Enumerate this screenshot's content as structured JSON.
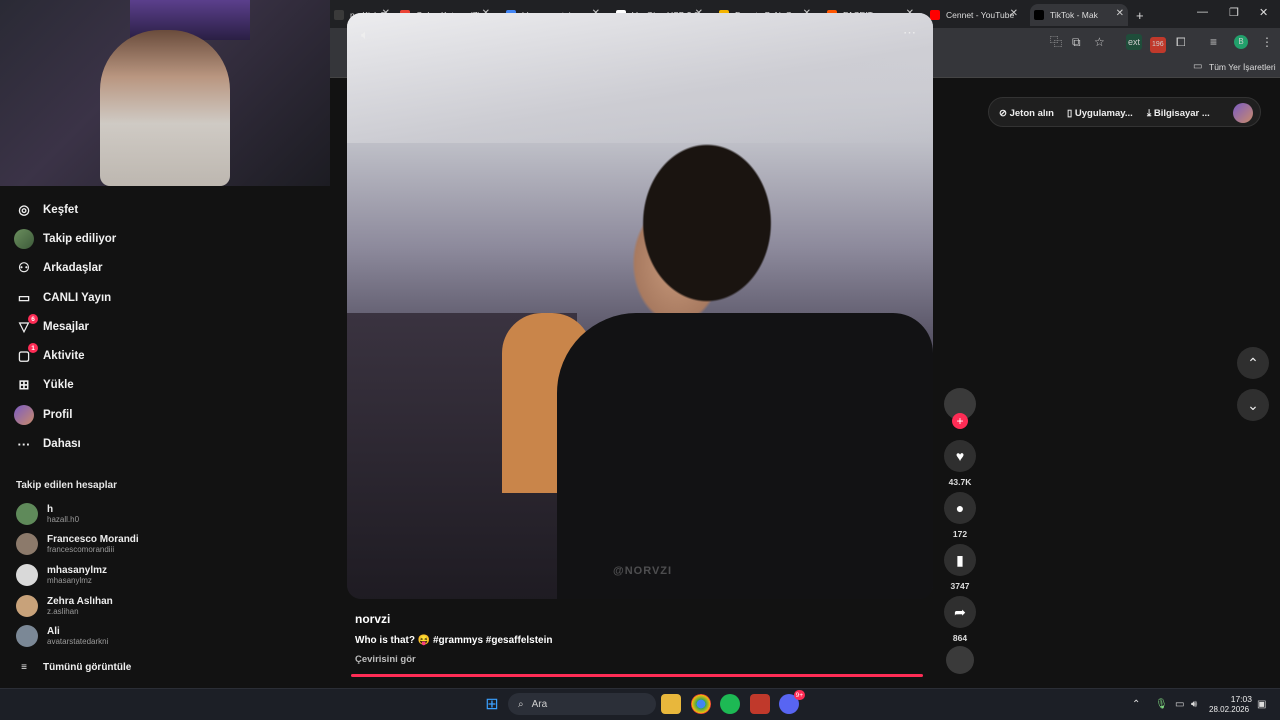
{
  "browser": {
    "tabs": [
      {
        "label": "n - Kick Da",
        "color": "#3a3a3a"
      },
      {
        "label": "Gelen Kutusu (7)",
        "color": "#ea4335"
      },
      {
        "label": "blue mountain s",
        "color": "#4285f4"
      },
      {
        "label": "VegGieg USB 3.0",
        "color": "#ffffff"
      },
      {
        "label": "Donate ByNoGa",
        "color": "#f4b400"
      },
      {
        "label": "FACEIT.com",
        "color": "#ff5500"
      },
      {
        "label": "Cennet - YouTube",
        "color": "#ff0000"
      },
      {
        "label": "TikTok - Mak",
        "color": "#000000"
      }
    ],
    "new_tab": "+",
    "bookmarks_label": "Tüm Yer İşaretleri",
    "profile_letter": "B",
    "ext_badge": "196"
  },
  "sidebar": {
    "items": [
      {
        "label": "Keşfet",
        "icon": "compass-icon",
        "glyph": "◎"
      },
      {
        "label": "Takip ediliyor",
        "icon": "following-avatar",
        "glyph": ""
      },
      {
        "label": "Arkadaşlar",
        "icon": "friends-icon",
        "glyph": "⚇"
      },
      {
        "label": "CANLI Yayın",
        "icon": "live-icon",
        "glyph": "▭"
      },
      {
        "label": "Mesajlar",
        "icon": "messages-icon",
        "glyph": "▽",
        "badge": "6"
      },
      {
        "label": "Aktivite",
        "icon": "activity-icon",
        "glyph": "▢",
        "badge": "1"
      },
      {
        "label": "Yükle",
        "icon": "upload-icon",
        "glyph": "⊞"
      },
      {
        "label": "Profil",
        "icon": "profile-avatar",
        "glyph": ""
      },
      {
        "label": "Dahası",
        "icon": "more-icon",
        "glyph": "···"
      }
    ],
    "following_title": "Takip edilen hesaplar",
    "accounts": [
      {
        "name": "h",
        "handle": "hazall.h0",
        "color": "#5f8a5a"
      },
      {
        "name": "Francesco Morandi",
        "handle": "francescomorandiii",
        "color": "#8c7a6b"
      },
      {
        "name": "mhasanylmz",
        "handle": "mhasanylmz",
        "color": "#d9d9d9"
      },
      {
        "name": "Zehra Aslıhan",
        "handle": "z.aslihan",
        "color": "#c8a27a"
      },
      {
        "name": "Ali",
        "handle": "avatarstatedarkni",
        "color": "#7b8896"
      }
    ],
    "see_all": "Tümünü görüntüle"
  },
  "video": {
    "author": "norvzi",
    "caption": "Who is that? 😝 #grammys #gesaffelstein",
    "translate": "Çevirisini gör",
    "watermark": "@NORVZI",
    "progress_fraction": 0.99
  },
  "actions": {
    "likes": "43.7K",
    "comments": "172",
    "saves": "3747",
    "shares": "864"
  },
  "topbar": {
    "coins": "Jeton alın",
    "app": "Uygulamay...",
    "desktop": "Bilgisayar ..."
  },
  "taskbar": {
    "search_placeholder": "Ara",
    "time": "17:03",
    "date": "28.02.2026",
    "discord_badge": "9+"
  }
}
